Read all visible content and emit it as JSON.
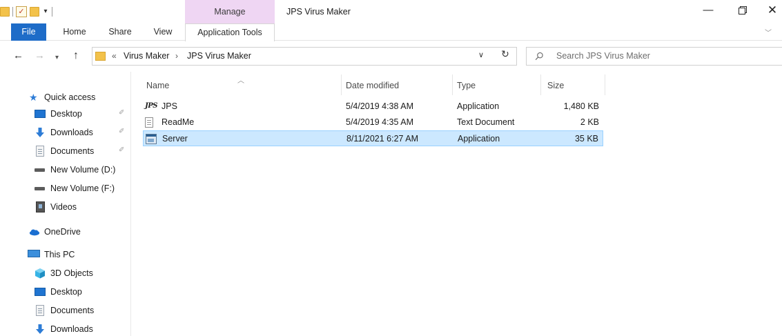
{
  "window": {
    "title": "JPS Virus Maker",
    "contextual_group": "Manage",
    "controls": {
      "minimize": "—",
      "close": "✕"
    }
  },
  "quick_access_toolbar": {
    "dropdown": "▾"
  },
  "ribbon": {
    "tabs": [
      {
        "label": "File",
        "active": true
      },
      {
        "label": "Home"
      },
      {
        "label": "Share"
      },
      {
        "label": "View"
      },
      {
        "label": "Application Tools"
      }
    ],
    "expand_icon": "chevron-down-icon"
  },
  "address_bar": {
    "overflow": "«",
    "crumbs": [
      "Virus Maker",
      "JPS Virus Maker"
    ],
    "separator": "›"
  },
  "search": {
    "placeholder": "Search JPS Virus Maker"
  },
  "nav_pane": {
    "quick_access": "Quick access",
    "items": [
      {
        "label": "Desktop",
        "icon": "desktop-icon",
        "pinned": true
      },
      {
        "label": "Downloads",
        "icon": "download-icon",
        "pinned": true
      },
      {
        "label": "Documents",
        "icon": "documents-icon",
        "pinned": true
      },
      {
        "label": "New Volume (D:)",
        "icon": "drive-icon"
      },
      {
        "label": "New Volume (F:)",
        "icon": "drive-icon"
      },
      {
        "label": "Videos",
        "icon": "videos-icon"
      }
    ],
    "onedrive": "OneDrive",
    "this_pc": "This PC",
    "pc_items": [
      {
        "label": "3D Objects",
        "icon": "3d-objects-icon"
      },
      {
        "label": "Desktop",
        "icon": "desktop-icon"
      },
      {
        "label": "Documents",
        "icon": "documents-icon"
      },
      {
        "label": "Downloads",
        "icon": "download-icon"
      }
    ]
  },
  "file_list": {
    "columns": {
      "name": "Name",
      "date": "Date modified",
      "type": "Type",
      "size": "Size"
    },
    "rows": [
      {
        "name": "JPS",
        "date": "5/4/2019 4:38 AM",
        "type": "Application",
        "size": "1,480 KB",
        "icon": "jps-app-icon",
        "selected": false
      },
      {
        "name": "ReadMe",
        "date": "5/4/2019 4:35 AM",
        "type": "Text Document",
        "size": "2 KB",
        "icon": "text-document-icon",
        "selected": false
      },
      {
        "name": "Server",
        "date": "8/11/2021 6:27 AM",
        "type": "Application",
        "size": "35 KB",
        "icon": "application-icon",
        "selected": true
      }
    ]
  },
  "colors": {
    "file_tab": "#1e6cc8",
    "manage_tab": "#efd6f3",
    "selection": "#cce8ff",
    "selection_border": "#99d1ff",
    "folder": "#f3c24a"
  }
}
